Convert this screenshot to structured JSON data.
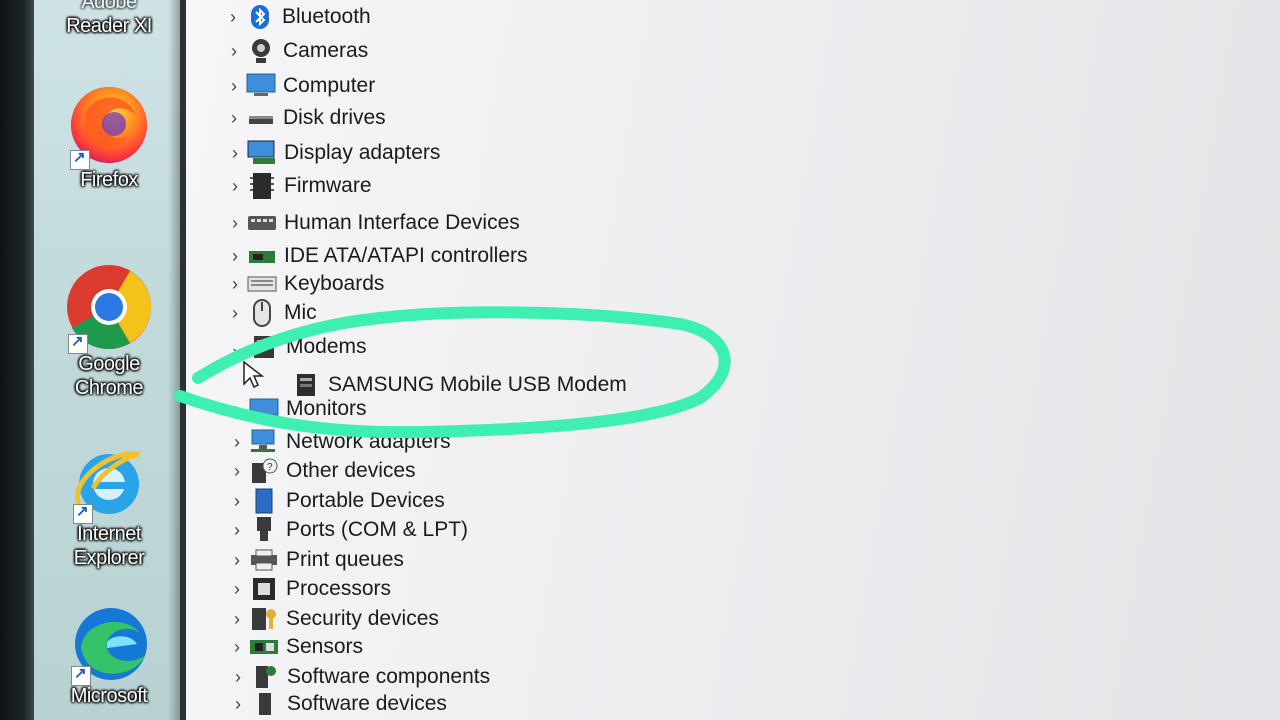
{
  "desktop": {
    "icons": [
      {
        "name": "reader-icon",
        "label": "Reader XI",
        "top_label_cut": "Adobe"
      },
      {
        "name": "firefox-icon",
        "label": "Firefox"
      },
      {
        "name": "chrome-icon",
        "label_line1": "Google",
        "label_line2": "Chrome"
      },
      {
        "name": "internet-explorer-icon",
        "label_line1": "Internet",
        "label_line2": "Explorer"
      },
      {
        "name": "edge-icon",
        "label": "Microsoft"
      }
    ]
  },
  "device_manager": {
    "categories": [
      {
        "label": "Bluetooth",
        "icon": "bluetooth-icon",
        "expanded": false
      },
      {
        "label": "Cameras",
        "icon": "camera-icon",
        "expanded": false
      },
      {
        "label": "Computer",
        "icon": "computer-icon",
        "expanded": false
      },
      {
        "label": "Disk drives",
        "icon": "disk-drive-icon",
        "expanded": false
      },
      {
        "label": "Display adapters",
        "icon": "display-adapter-icon",
        "expanded": false
      },
      {
        "label": "Firmware",
        "icon": "firmware-icon",
        "expanded": false
      },
      {
        "label": "Human Interface Devices",
        "icon": "hid-icon",
        "expanded": false
      },
      {
        "label": "IDE ATA/ATAPI controllers",
        "icon": "ide-controller-icon",
        "expanded": false
      },
      {
        "label": "Keyboards",
        "icon": "keyboard-icon",
        "expanded": false
      },
      {
        "label": "Mic",
        "icon": "mouse-icon",
        "expanded": false
      },
      {
        "label": "Modems",
        "icon": "modem-icon",
        "expanded": true
      },
      {
        "label": "Monitors",
        "icon": "monitor-icon",
        "expanded": false
      },
      {
        "label": "Network adapters",
        "icon": "network-adapter-icon",
        "expanded": false
      },
      {
        "label": "Other devices",
        "icon": "other-devices-icon",
        "expanded": false
      },
      {
        "label": "Portable Devices",
        "icon": "portable-device-icon",
        "expanded": false
      },
      {
        "label": "Ports (COM & LPT)",
        "icon": "port-icon",
        "expanded": false
      },
      {
        "label": "Print queues",
        "icon": "printer-icon",
        "expanded": false
      },
      {
        "label": "Processors",
        "icon": "processor-icon",
        "expanded": false
      },
      {
        "label": "Security devices",
        "icon": "security-device-icon",
        "expanded": false
      },
      {
        "label": "Sensors",
        "icon": "sensor-icon",
        "expanded": false
      },
      {
        "label": "Software components",
        "icon": "software-component-icon",
        "expanded": false
      },
      {
        "label": "Software devices",
        "icon": "software-device-icon",
        "expanded": false
      }
    ],
    "modem_child": {
      "label": "SAMSUNG Mobile USB Modem",
      "icon": "modem-device-icon"
    }
  },
  "colors": {
    "highlight": "#3ef0b0",
    "chevron_open": "#2b6cc4",
    "monitor_blue": "#3c8fd8"
  }
}
